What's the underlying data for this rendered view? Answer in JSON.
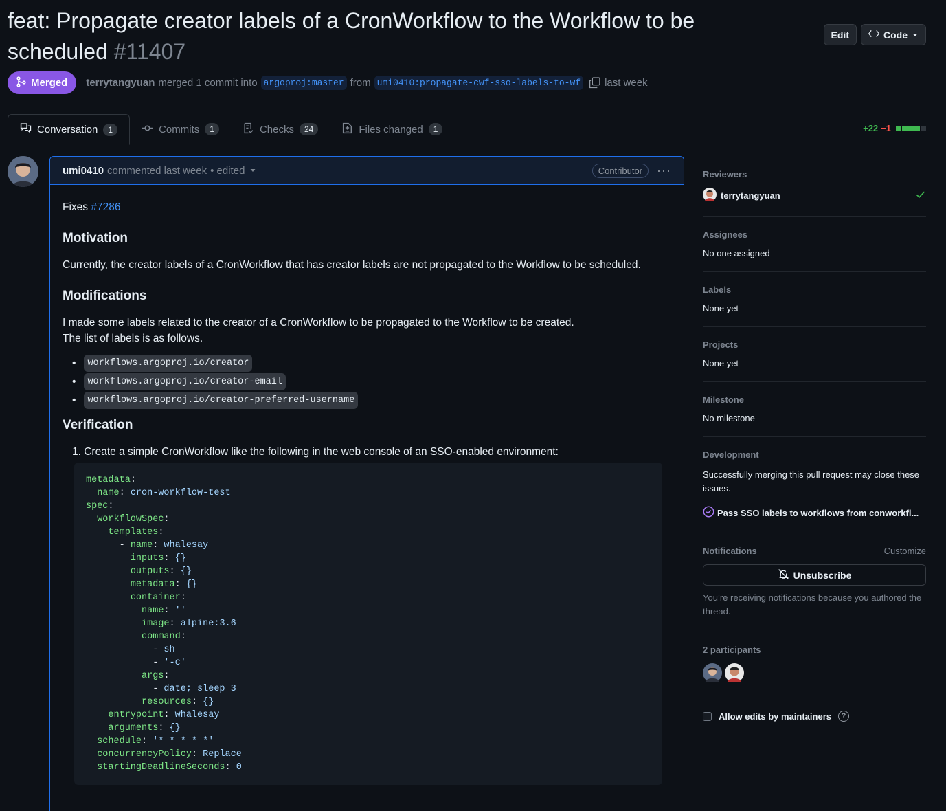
{
  "pr": {
    "title": "feat: Propagate creator labels of a CronWorkflow to the Workflow to be scheduled",
    "number": "#11407",
    "state": "Merged",
    "merger": "terrytangyuan",
    "merge_text": "merged 1 commit into",
    "base_branch": "argoproj:master",
    "from_text": "from",
    "head_branch": "umi0410:propagate-cwf-sso-labels-to-wf",
    "time": "last week"
  },
  "actions": {
    "edit": "Edit",
    "code": "Code"
  },
  "tabs": [
    {
      "label": "Conversation",
      "count": "1"
    },
    {
      "label": "Commits",
      "count": "1"
    },
    {
      "label": "Checks",
      "count": "24"
    },
    {
      "label": "Files changed",
      "count": "1"
    }
  ],
  "diffstat": {
    "additions": "+22",
    "deletions": "−1"
  },
  "comment": {
    "author": "umi0410",
    "meta": "commented last week",
    "edited": "• edited",
    "badge": "Contributor",
    "fixes_prefix": "Fixes",
    "fixes_link": "#7286",
    "h_motivation": "Motivation",
    "motivation": "Currently, the creator labels of a CronWorkflow that has creator labels are not propagated to the Workflow to be scheduled.",
    "h_modifications": "Modifications",
    "mod_line1": "I made some labels related to the creator of a CronWorkflow to be propagated to the Workflow to be created.",
    "mod_line2": "The list of labels is as follows.",
    "labels": [
      "workflows.argoproj.io/creator",
      "workflows.argoproj.io/creator-email",
      "workflows.argoproj.io/creator-preferred-username"
    ],
    "h_verification": "Verification",
    "step1": "Create a simple CronWorkflow like the following in the web console of an SSO-enabled environment:"
  },
  "sidebar": {
    "reviewers_title": "Reviewers",
    "reviewer": "terrytangyuan",
    "assignees_title": "Assignees",
    "assignees": "No one assigned",
    "labels_title": "Labels",
    "labels": "None yet",
    "projects_title": "Projects",
    "projects": "None yet",
    "milestone_title": "Milestone",
    "milestone": "No milestone",
    "development_title": "Development",
    "development_text": "Successfully merging this pull request may close these issues.",
    "development_issue": "Pass SSO labels to workflows from conworkfl...",
    "notifications_title": "Notifications",
    "customize": "Customize",
    "unsubscribe": "Unsubscribe",
    "notif_reason": "You’re receiving notifications because you authored the thread.",
    "participants_title": "2 participants",
    "allow_edits": "Allow edits by maintainers"
  },
  "colors": {
    "merged": "#8957e5",
    "link": "#4493f8",
    "add": "#3fb950",
    "del": "#f85149"
  },
  "icons": [
    "git-merge-icon",
    "copy-icon",
    "comment-discussion-icon",
    "git-commit-icon",
    "checklist-icon",
    "file-diff-icon",
    "kebab-horizontal-icon",
    "check-icon",
    "issue-closed-icon",
    "bell-slash-icon",
    "question-icon",
    "code-icon",
    "triangle-down-icon"
  ]
}
